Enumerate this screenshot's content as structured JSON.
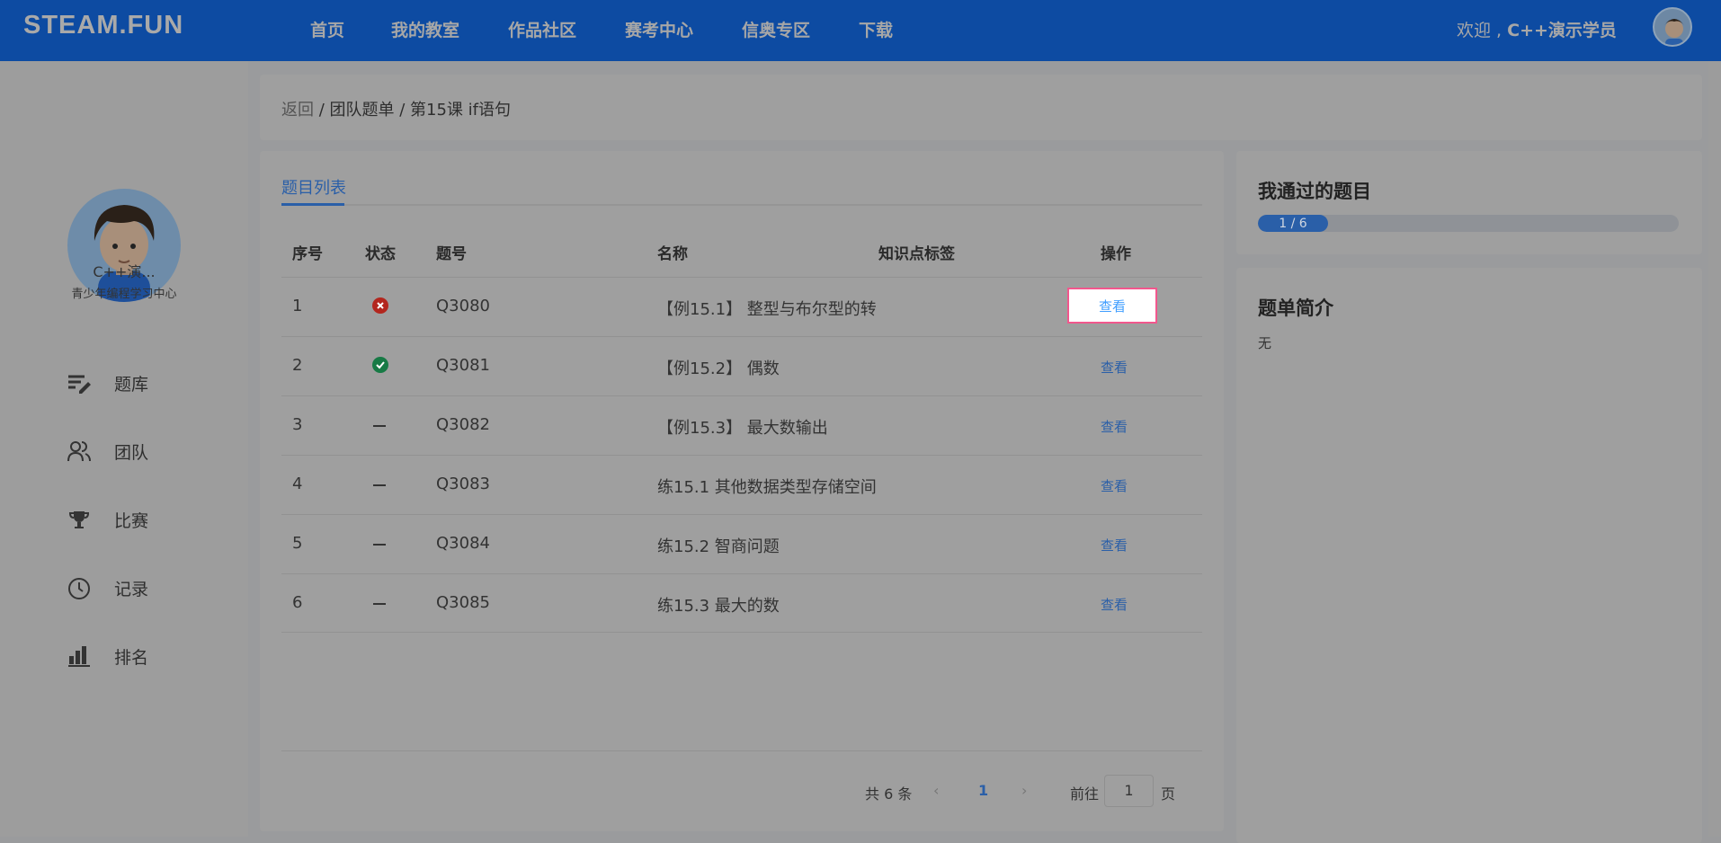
{
  "header": {
    "logo": "STEAM.FUN",
    "nav": [
      "首页",
      "我的教室",
      "作品社区",
      "赛考中心",
      "信奥专区",
      "下载"
    ],
    "welcome_prefix": "欢迎 , ",
    "username": "C++演示学员"
  },
  "sidebar": {
    "name": "C++演...",
    "org": "青少年编程学习中心",
    "items": [
      {
        "label": "题库",
        "icon": "list-edit-icon"
      },
      {
        "label": "团队",
        "icon": "users-icon"
      },
      {
        "label": "比赛",
        "icon": "trophy-icon"
      },
      {
        "label": "记录",
        "icon": "clock-icon"
      },
      {
        "label": "排名",
        "icon": "bar-chart-icon"
      }
    ]
  },
  "breadcrumb": {
    "back": "返回",
    "sep1": " / ",
    "team": "团队题单",
    "sep2": " / ",
    "current": "第15课 if语句"
  },
  "main": {
    "tab": "题目列表",
    "columns": [
      "序号",
      "状态",
      "题号",
      "名称",
      "知识点标签",
      "操作"
    ],
    "rows": [
      {
        "index": "1",
        "status": "failed",
        "id": "Q3080",
        "name": "【例15.1】 整型与布尔型的转",
        "action": "查看"
      },
      {
        "index": "2",
        "status": "passed",
        "id": "Q3081",
        "name": "【例15.2】 偶数",
        "action": "查看"
      },
      {
        "index": "3",
        "status": "none",
        "id": "Q3082",
        "name": "【例15.3】 最大数输出",
        "action": "查看"
      },
      {
        "index": "4",
        "status": "none",
        "id": "Q3083",
        "name": "练15.1 其他数据类型存储空间",
        "action": "查看"
      },
      {
        "index": "5",
        "status": "none",
        "id": "Q3084",
        "name": "练15.2 智商问题",
        "action": "查看"
      },
      {
        "index": "6",
        "status": "none",
        "id": "Q3085",
        "name": "练15.3 最大的数",
        "action": "查看"
      }
    ],
    "pagination": {
      "total": "共 6 条",
      "current": "1",
      "goto_label": "前往",
      "goto_value": "1",
      "page_suffix": "页"
    }
  },
  "right": {
    "passed_title": "我通过的题目",
    "progress_text": "1 / 6",
    "progress_fraction": 0.1667,
    "intro_title": "题单简介",
    "intro": "无"
  },
  "colors": {
    "header": "#0d4ba2",
    "accent": "#2a5fa8",
    "highlight_border": "#f2578d",
    "failed": "#b3261e",
    "passed": "#177a45"
  }
}
